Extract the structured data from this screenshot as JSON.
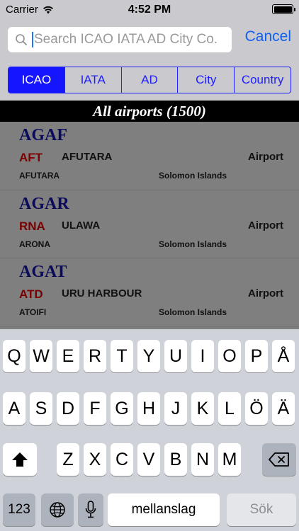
{
  "status_bar": {
    "carrier": "Carrier",
    "time": "4:52 PM"
  },
  "search": {
    "placeholder": "Search ICAO IATA AD City Co...",
    "value": "",
    "cancel_label": "Cancel"
  },
  "segments": [
    {
      "label": "ICAO",
      "active": true
    },
    {
      "label": "IATA",
      "active": false
    },
    {
      "label": "AD",
      "active": false
    },
    {
      "label": "City",
      "active": false
    },
    {
      "label": "Country",
      "active": false
    }
  ],
  "list_header": "All airports (1500)",
  "airports": [
    {
      "icao": "AGAF",
      "iata": "AFT",
      "name": "AFUTARA",
      "type": "Airport",
      "city": "AFUTARA",
      "country": "Solomon Islands"
    },
    {
      "icao": "AGAR",
      "iata": "RNA",
      "name": "ULAWA",
      "type": "Airport",
      "city": "ARONA",
      "country": "Solomon Islands"
    },
    {
      "icao": "AGAT",
      "iata": "ATD",
      "name": "URU HARBOUR",
      "type": "Airport",
      "city": "ATOIFI",
      "country": "Solomon Islands"
    }
  ],
  "keyboard": {
    "row1": [
      "Q",
      "W",
      "E",
      "R",
      "T",
      "Y",
      "U",
      "I",
      "O",
      "P",
      "Å"
    ],
    "row2": [
      "A",
      "S",
      "D",
      "F",
      "G",
      "H",
      "J",
      "K",
      "L",
      "Ö",
      "Ä"
    ],
    "row3": [
      "Z",
      "X",
      "C",
      "V",
      "B",
      "N",
      "M"
    ],
    "numbers_label": "123",
    "space_label": "mellanslag",
    "search_label": "Sök"
  },
  "colors": {
    "accent": "#1515ff",
    "cancel": "#1060f2",
    "icao": "#0b0b5c",
    "iata": "#7a0000"
  }
}
